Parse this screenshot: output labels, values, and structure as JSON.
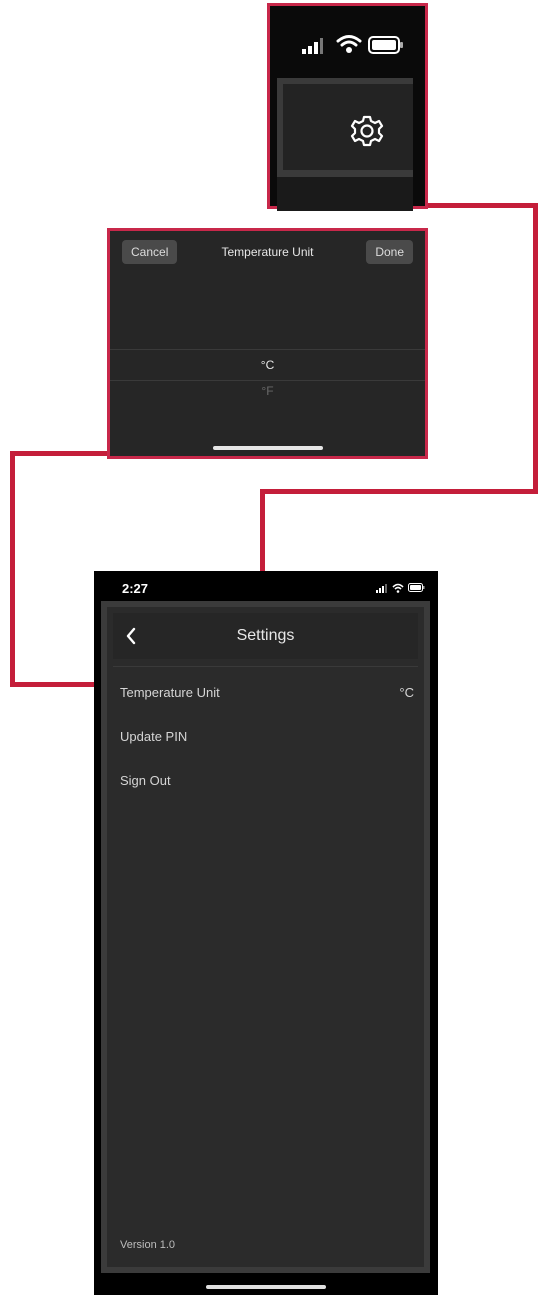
{
  "gear_callout": {
    "icons": [
      "signal-icon",
      "wifi-icon",
      "battery-icon",
      "gear-icon"
    ]
  },
  "picker": {
    "cancel_label": "Cancel",
    "title": "Temperature Unit",
    "done_label": "Done",
    "options": [
      {
        "label": "°C",
        "selected": true
      },
      {
        "label": "°F",
        "selected": false
      }
    ]
  },
  "phone": {
    "status": {
      "time": "2:27"
    },
    "header": {
      "title": "Settings"
    },
    "menu": [
      {
        "label": "Temperature Unit",
        "value": "°C"
      },
      {
        "label": "Update PIN"
      },
      {
        "label": "Sign Out"
      }
    ],
    "version": "Version 1.0"
  },
  "colors": {
    "accent": "#c41e3a",
    "background": "#2b2b2b",
    "text": "#d5d5d5"
  }
}
